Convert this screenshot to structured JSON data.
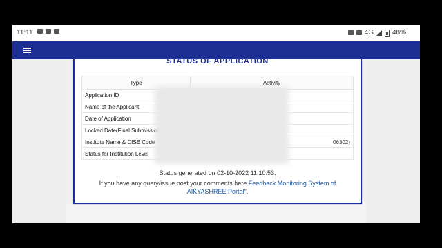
{
  "statusbar": {
    "time": "11:11",
    "network": "4G",
    "battery": "48%"
  },
  "card": {
    "title": "STATUS OF APPLICATION"
  },
  "table": {
    "headers": [
      "Type",
      "Activity"
    ],
    "rows": [
      {
        "label": "Application ID",
        "value": ""
      },
      {
        "label": "Name of the Applicant",
        "value": ""
      },
      {
        "label": "Date of Application",
        "value": ""
      },
      {
        "label": "Locked Date(Final Submission)",
        "value": ""
      },
      {
        "label": "Institute Name & DISE Code",
        "value": "06302)"
      },
      {
        "label": "Status for Institution Level",
        "value": ""
      }
    ]
  },
  "footer": {
    "status_generated": "Status generated on 02-10-2022 11:10:53.",
    "query_prefix": "If you have any query/issue post your comments here",
    "link_text": "Feedback Monitoring System of AIKYASHREE Portal",
    "query_suffix": "\"."
  }
}
